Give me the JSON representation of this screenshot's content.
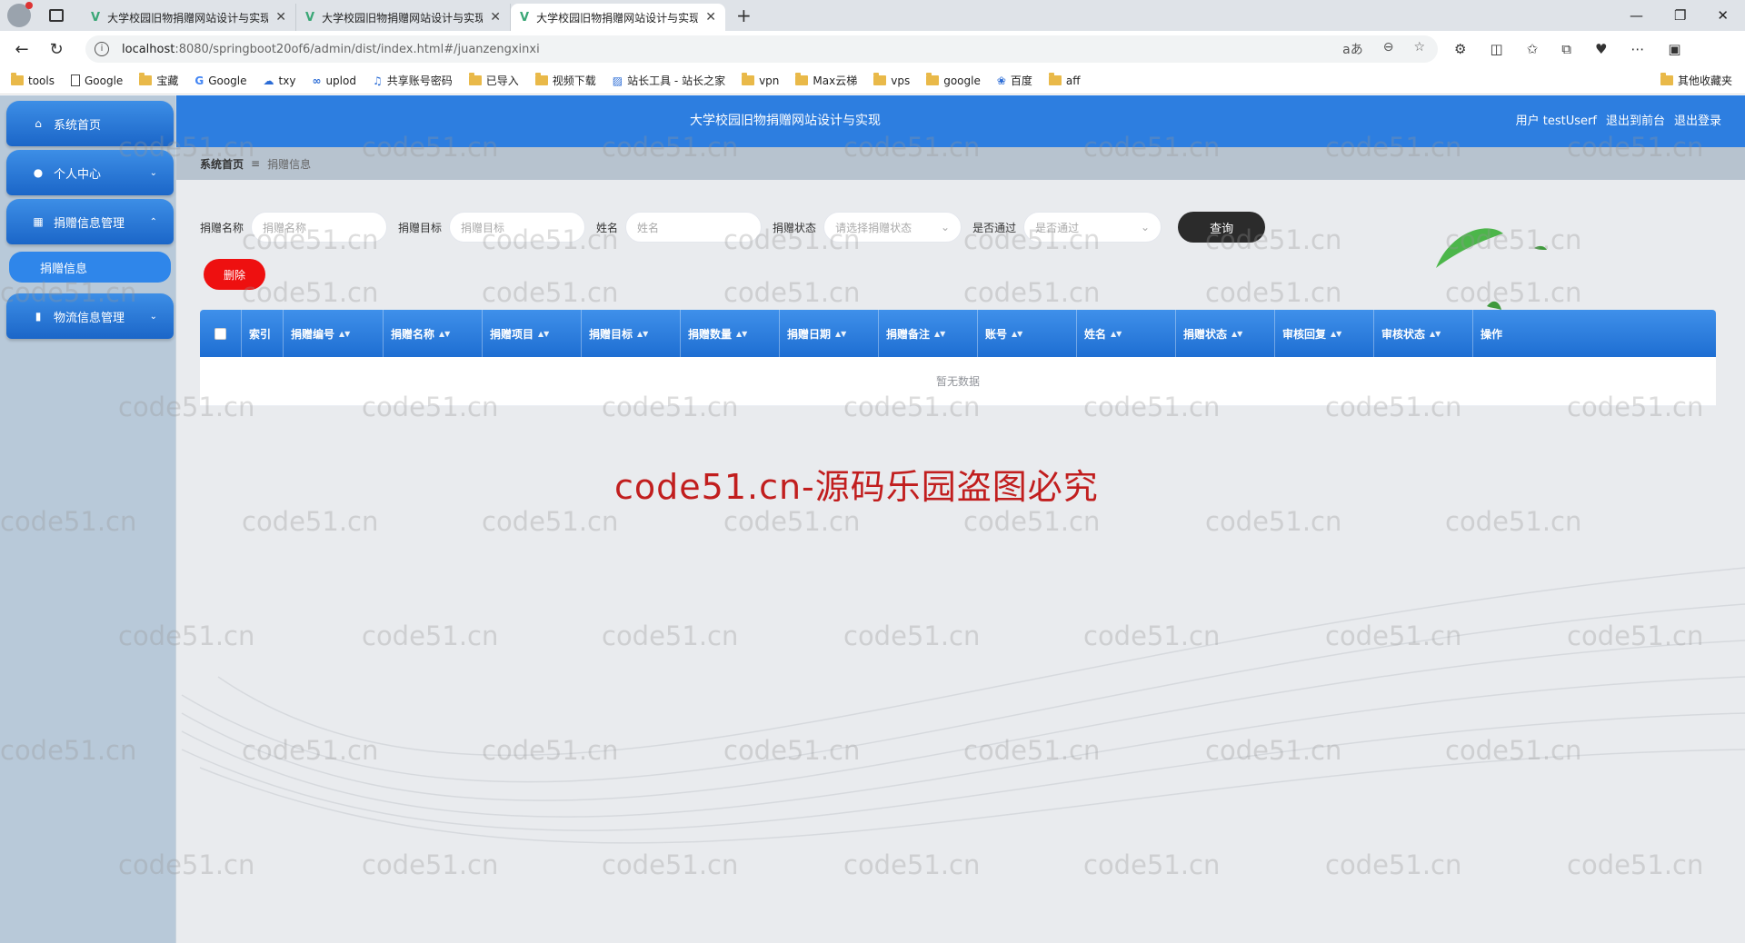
{
  "browser": {
    "tabs": [
      {
        "title": "大学校园旧物捐赠网站设计与实现"
      },
      {
        "title": "大学校园旧物捐赠网站设计与实现"
      },
      {
        "title": "大学校园旧物捐赠网站设计与实现"
      }
    ],
    "url_host": "localhost",
    "url_rest": ":8080/springboot20of6/admin/dist/index.html#/juanzengxinxi",
    "bookmarks": [
      "tools",
      "Google",
      "宝藏",
      "Google",
      "txy",
      "uplod",
      "共享账号密码",
      "已导入",
      "视频下载",
      "站长工具 - 站长之家",
      "vpn",
      "Max云梯",
      "vps",
      "google",
      "百度",
      "aff"
    ],
    "bookmarks_other": "其他收藏夹"
  },
  "sidebar": {
    "home": "系统首页",
    "personal": "个人中心",
    "donation_mgmt": "捐赠信息管理",
    "donation_info": "捐赠信息",
    "logistics_mgmt": "物流信息管理"
  },
  "header": {
    "title": "大学校园旧物捐赠网站设计与实现",
    "user_prefix": "用户",
    "username": "testUserf",
    "front": "退出到前台",
    "logout": "退出登录"
  },
  "breadcrumb": {
    "home": "系统首页",
    "current": "捐赠信息"
  },
  "search": {
    "name_label": "捐赠名称",
    "name_placeholder": "捐赠名称",
    "target_label": "捐赠目标",
    "target_placeholder": "捐赠目标",
    "person_label": "姓名",
    "person_placeholder": "姓名",
    "status_label": "捐赠状态",
    "status_placeholder": "请选择捐赠状态",
    "pass_label": "是否通过",
    "pass_placeholder": "是否通过",
    "query": "查询"
  },
  "actions": {
    "delete": "删除"
  },
  "table": {
    "columns": [
      "索引",
      "捐赠编号",
      "捐赠名称",
      "捐赠项目",
      "捐赠目标",
      "捐赠数量",
      "捐赠日期",
      "捐赠备注",
      "账号",
      "姓名",
      "捐赠状态",
      "审核回复",
      "审核状态",
      "操作"
    ],
    "empty_text": "暂无数据"
  },
  "watermark": {
    "big": "code51.cn-源码乐园盗图必究",
    "small": "code51.cn"
  },
  "colors": {
    "primary": "#2d7ee0",
    "danger": "#ee1010",
    "dark_button": "#2b2b2b"
  }
}
